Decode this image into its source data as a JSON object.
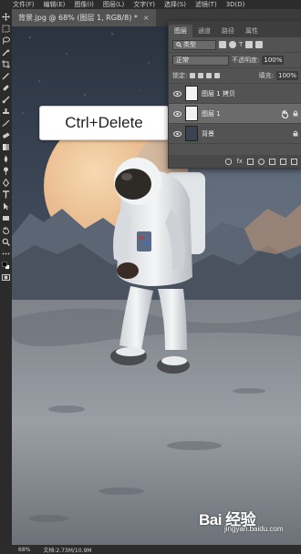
{
  "menu": {
    "items": [
      "文件(F)",
      "编辑(E)",
      "图像(I)",
      "图层(L)",
      "文字(Y)",
      "选择(S)",
      "滤镜(T)",
      "3D(D)"
    ]
  },
  "document": {
    "tab_title": "背景.jpg @ 68% (图层 1, RGB/8) *",
    "close_glyph": "×"
  },
  "tooltip": {
    "text": "Ctrl+Delete"
  },
  "layers_panel": {
    "tabs": [
      {
        "label": "图层",
        "active": true
      },
      {
        "label": "通道",
        "active": false
      },
      {
        "label": "路径",
        "active": false
      },
      {
        "label": "属性",
        "active": false
      }
    ],
    "filter_label": "类型",
    "blend_mode": "正常",
    "opacity_label": "不透明度:",
    "opacity_value": "100%",
    "lock_label": "锁定:",
    "fill_label": "填充:",
    "fill_value": "100%",
    "layers": [
      {
        "name": "图层 1 拷贝",
        "visible": true,
        "selected": false,
        "thumb": "white"
      },
      {
        "name": "图层 1",
        "visible": true,
        "selected": true,
        "thumb": "white",
        "locked": true
      },
      {
        "name": "背景",
        "visible": true,
        "selected": false,
        "thumb": "dark",
        "locked": true
      }
    ],
    "footer_icons": [
      "link-icon",
      "fx-icon",
      "mask-icon",
      "adjustment-icon",
      "group-icon",
      "new-layer-icon",
      "trash-icon"
    ],
    "fx_text": "fx"
  },
  "status": {
    "zoom": "68%",
    "doc_info": "文档:2.73M/10.9M"
  },
  "watermark": {
    "logo": "Bai 经验",
    "url": "jingyan.baidu.com"
  },
  "colors": {
    "sky": "#3d4a5c",
    "planet": "#e9b98b",
    "ground": "#8d9198",
    "ui_dark": "#2c2c2c"
  }
}
